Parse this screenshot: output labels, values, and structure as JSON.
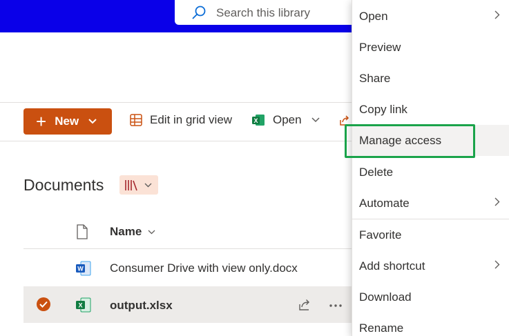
{
  "header": {
    "search_placeholder": "Search this library"
  },
  "commandbar": {
    "new_label": "New",
    "edit_grid_label": "Edit in grid view",
    "open_label": "Open"
  },
  "library": {
    "title": "Documents",
    "column_name": "Name",
    "files": [
      {
        "name": "Consumer Drive with view only.docx",
        "type": "word",
        "selected": false
      },
      {
        "name": "output.xlsx",
        "type": "excel",
        "selected": true
      }
    ]
  },
  "context_menu": {
    "items": [
      {
        "label": "Open",
        "submenu": true
      },
      {
        "label": "Preview",
        "submenu": false
      },
      {
        "label": "Share",
        "submenu": false
      },
      {
        "label": "Copy link",
        "submenu": false
      },
      {
        "label": "Manage access",
        "submenu": false,
        "highlighted": true
      },
      {
        "label": "Delete",
        "submenu": false
      },
      {
        "label": "Automate",
        "submenu": true
      },
      {
        "label": "Favorite",
        "submenu": false
      },
      {
        "label": "Add shortcut",
        "submenu": true
      },
      {
        "label": "Download",
        "submenu": false
      },
      {
        "label": "Rename",
        "submenu": false
      }
    ]
  },
  "colors": {
    "suite_bar": "#0a00e8",
    "accent": "#ca5010",
    "highlight_border": "#1aa34a",
    "excel_green": "#107c41",
    "word_blue": "#185abd"
  }
}
